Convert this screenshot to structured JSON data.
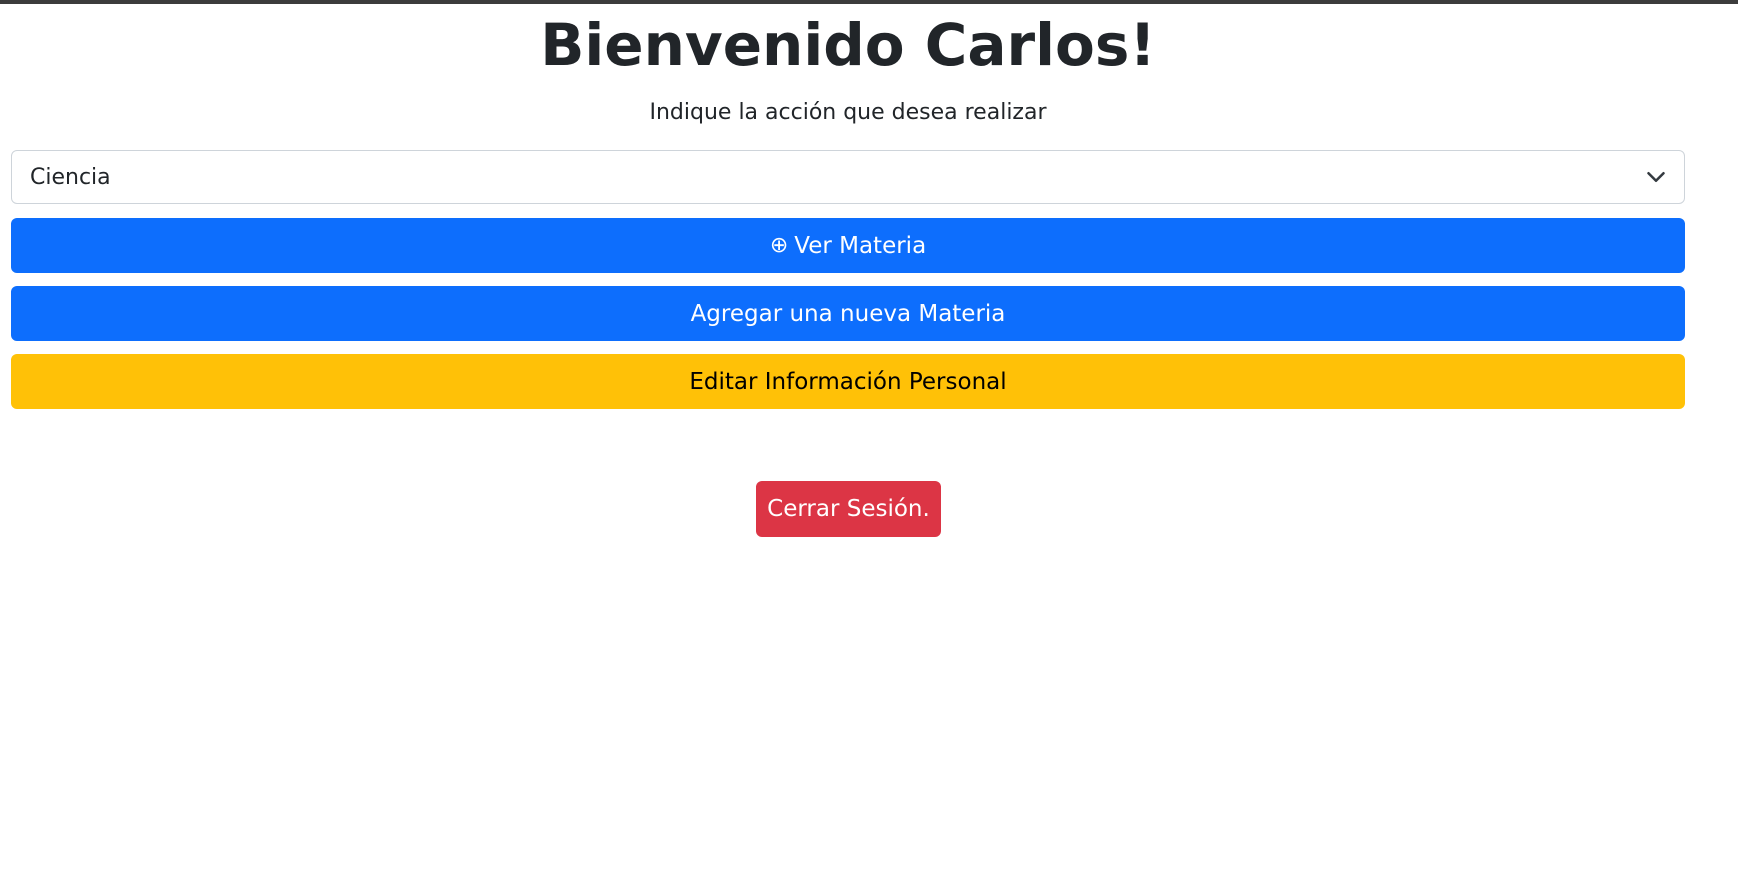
{
  "page": {
    "title": "Bienvenido Carlos!",
    "subtitle": "Indique la acción que desea realizar"
  },
  "select": {
    "selected": "Ciencia",
    "icon": "chevron-down-icon"
  },
  "buttons": {
    "ver_icon": "⊕",
    "ver_label": "Ver Materia",
    "agregar_label": "Agregar una nueva Materia",
    "editar_label": "Editar Información Personal",
    "logout_label": "Cerrar Sesión."
  },
  "colors": {
    "primary": "#0d6efd",
    "warning": "#ffc107",
    "danger": "#dc3545"
  }
}
